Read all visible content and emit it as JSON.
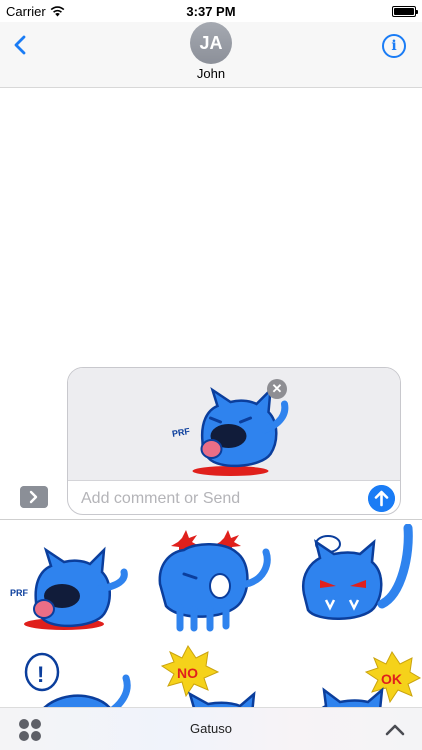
{
  "status_bar": {
    "carrier": "Carrier",
    "time": "3:37 PM",
    "wifi_icon": "wifi-icon",
    "battery_icon": "battery-icon",
    "battery_level": 1.0
  },
  "header": {
    "back_icon": "chevron-left-icon",
    "avatar_initials": "JA",
    "contact_name": "John",
    "info_icon": "info-icon"
  },
  "composer": {
    "placeholder": "Add comment or Send",
    "value": "",
    "attachment": "blue-cat-sticker-tongue",
    "remove_icon_glyph": "✕",
    "send_icon": "arrow-up-icon"
  },
  "expand_icon": "chevron-right-icon",
  "stickers": [
    {
      "name": "blue-cat-tongue-sticker",
      "caption": "PRF"
    },
    {
      "name": "blue-cat-dizzy-sticker"
    },
    {
      "name": "blue-cat-angry-sticker"
    },
    {
      "name": "blue-cat-surprised-sticker"
    },
    {
      "name": "blue-cat-no-sticker",
      "caption": "NO"
    },
    {
      "name": "blue-cat-ok-sticker",
      "caption": "OK"
    }
  ],
  "drawer": {
    "apps_icon": "app-grid-icon",
    "title": "Gatuso",
    "expand_icon": "chevron-up-icon"
  },
  "colors": {
    "accent": "#1a7cf5",
    "sticker_blue": "#2f83ee",
    "sticker_red": "#e0201c",
    "sticker_yellow": "#f5d21a"
  }
}
